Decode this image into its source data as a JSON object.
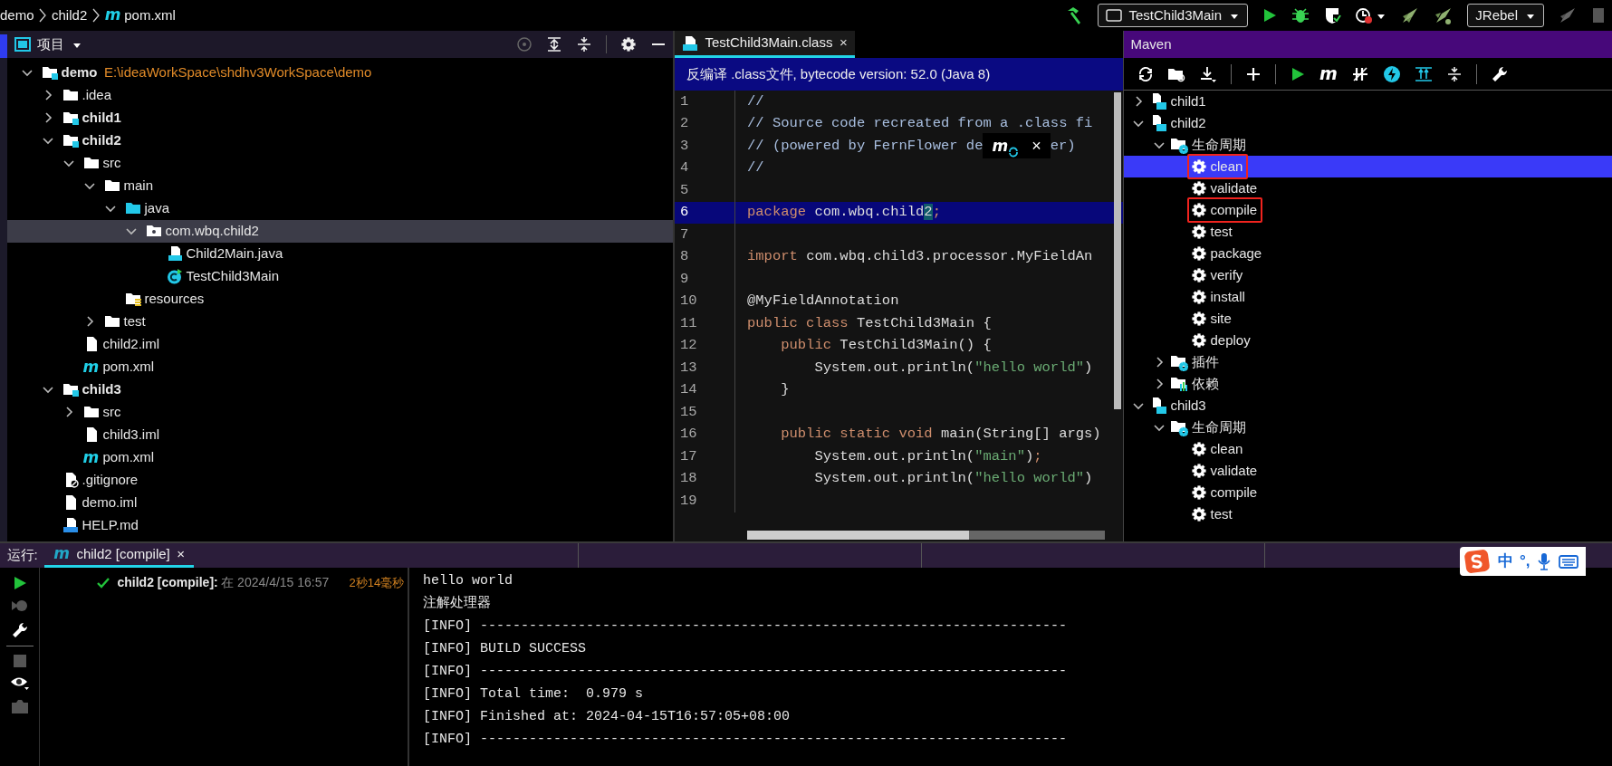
{
  "breadcrumbs": [
    {
      "label": "demo"
    },
    {
      "label": "child2"
    },
    {
      "label": "pom.xml",
      "badge": "m"
    }
  ],
  "toolbar": {
    "run_config": "TestChild3Main",
    "plugin": "JRebel"
  },
  "project_panel": {
    "title": "项目",
    "tree": [
      {
        "label": "demo",
        "kind": "module",
        "bold": true,
        "path": "E:\\ideaWorkSpace\\shdhv3WorkSpace\\demo",
        "expanded": true,
        "selected": false,
        "children": [
          {
            "label": ".idea",
            "kind": "folder",
            "expanded": false,
            "selected": false
          },
          {
            "label": "child1",
            "kind": "module",
            "bold": true,
            "expanded": false,
            "selected": false
          },
          {
            "label": "child2",
            "kind": "module",
            "bold": true,
            "expanded": true,
            "selected": false,
            "children": [
              {
                "label": "src",
                "kind": "folder",
                "expanded": true,
                "selected": false,
                "children": [
                  {
                    "label": "main",
                    "kind": "folder",
                    "expanded": true,
                    "selected": false,
                    "children": [
                      {
                        "label": "java",
                        "kind": "source-folder",
                        "expanded": true,
                        "selected": false,
                        "children": [
                          {
                            "label": "com.wbq.child2",
                            "kind": "package",
                            "expanded": true,
                            "selected": true,
                            "children": [
                              {
                                "label": "Child2Main.java",
                                "kind": "java-file",
                                "selected": false
                              },
                              {
                                "label": "TestChild3Main",
                                "kind": "class",
                                "selected": false
                              }
                            ]
                          }
                        ]
                      },
                      {
                        "label": "resources",
                        "kind": "resources",
                        "selected": false
                      }
                    ]
                  },
                  {
                    "label": "test",
                    "kind": "folder",
                    "expanded": false,
                    "selected": false
                  }
                ]
              },
              {
                "label": "child2.iml",
                "kind": "iml",
                "selected": false
              },
              {
                "label": "pom.xml",
                "kind": "pom",
                "badge": "m",
                "selected": false
              }
            ]
          },
          {
            "label": "child3",
            "kind": "module",
            "bold": true,
            "expanded": true,
            "selected": false,
            "children": [
              {
                "label": "src",
                "kind": "folder",
                "expanded": false,
                "selected": false
              },
              {
                "label": "child3.iml",
                "kind": "iml",
                "selected": false
              },
              {
                "label": "pom.xml",
                "kind": "pom",
                "badge": "m",
                "selected": false
              }
            ]
          },
          {
            "label": ".gitignore",
            "kind": "gitignore",
            "selected": false
          },
          {
            "label": "demo.iml",
            "kind": "iml",
            "selected": false
          },
          {
            "label": "HELP.md",
            "kind": "md",
            "selected": false
          }
        ]
      }
    ]
  },
  "editor": {
    "tab": {
      "label": "TestChild3Main.class",
      "close": "×",
      "selected": true
    },
    "banner": "反编译 .class文件, bytecode version: 52.0 (Java 8)",
    "lines": [
      {
        "number": "1",
        "current": false,
        "tokens": [
          {
            "kind": "comment",
            "text": "//"
          }
        ]
      },
      {
        "number": "2",
        "current": false,
        "tokens": [
          {
            "kind": "comment",
            "text": "// Source code recreated from a .class fi"
          }
        ]
      },
      {
        "number": "3",
        "current": false,
        "tokens": [
          {
            "kind": "comment",
            "text": "// (powered by FernFlower de"
          },
          {
            "kind": "popup",
            "badge": "m",
            "close": "×"
          },
          {
            "kind": "comment",
            "text": "er)"
          }
        ]
      },
      {
        "number": "4",
        "current": false,
        "tokens": [
          {
            "kind": "comment",
            "text": "//"
          }
        ]
      },
      {
        "number": "5",
        "current": false
      },
      {
        "number": "6",
        "current": true,
        "tokens": [
          {
            "kind": "keyword",
            "text": "package "
          },
          {
            "kind": "plain",
            "text": "com.wbq.child"
          },
          {
            "kind": "match",
            "text": "2"
          },
          {
            "kind": "keyword",
            "text": ";"
          }
        ]
      },
      {
        "number": "7",
        "current": false
      },
      {
        "number": "8",
        "current": false,
        "tokens": [
          {
            "kind": "keyword",
            "text": "import "
          },
          {
            "kind": "plain",
            "text": "com.wbq.child3.processor.MyFieldAn"
          }
        ]
      },
      {
        "number": "9",
        "current": false
      },
      {
        "number": "10",
        "current": false,
        "tokens": [
          {
            "kind": "plain",
            "text": "@MyFieldAnnotation"
          }
        ]
      },
      {
        "number": "11",
        "current": false,
        "tokens": [
          {
            "kind": "keyword",
            "text": "public class "
          },
          {
            "kind": "plain",
            "text": "TestChild3Main {"
          }
        ]
      },
      {
        "number": "12",
        "current": false,
        "tokens": [
          {
            "kind": "keyword",
            "text": "    public "
          },
          {
            "kind": "plain",
            "text": "TestChild3Main() {"
          }
        ]
      },
      {
        "number": "13",
        "current": false,
        "tokens": [
          {
            "kind": "plain",
            "text": "        System.out.println("
          },
          {
            "kind": "string",
            "text": "\"hello world\""
          },
          {
            "kind": "plain",
            "text": ")"
          }
        ]
      },
      {
        "number": "14",
        "current": false,
        "tokens": [
          {
            "kind": "plain",
            "text": "    }"
          }
        ]
      },
      {
        "number": "15",
        "current": false
      },
      {
        "number": "16",
        "current": false,
        "tokens": [
          {
            "kind": "keyword",
            "text": "    public static void "
          },
          {
            "kind": "plain",
            "text": "main(String[] args)"
          }
        ]
      },
      {
        "number": "17",
        "current": false,
        "tokens": [
          {
            "kind": "plain",
            "text": "        System.out.println("
          },
          {
            "kind": "string",
            "text": "\"main\""
          },
          {
            "kind": "plain",
            "text": ")"
          },
          {
            "kind": "keyword",
            "text": ";"
          }
        ]
      },
      {
        "number": "18",
        "current": false,
        "tokens": [
          {
            "kind": "plain",
            "text": "        System.out.println("
          },
          {
            "kind": "string",
            "text": "\"hello world\""
          },
          {
            "kind": "plain",
            "text": ")"
          }
        ]
      },
      {
        "number": "19",
        "current": false
      }
    ]
  },
  "maven": {
    "title": "Maven",
    "toolbar_badge": "m",
    "tree": [
      {
        "label": "child1",
        "kind": "module",
        "expanded": false,
        "selected": false,
        "marked": false
      },
      {
        "label": "child2",
        "kind": "module",
        "expanded": true,
        "selected": false,
        "marked": false,
        "children": [
          {
            "label": "生命周期",
            "kind": "lifecycle",
            "expanded": true,
            "selected": false,
            "marked": false,
            "children": [
              {
                "label": "clean",
                "kind": "goal",
                "selected": true,
                "marked": true
              },
              {
                "label": "validate",
                "kind": "goal",
                "selected": false,
                "marked": false
              },
              {
                "label": "compile",
                "kind": "goal",
                "selected": false,
                "marked": true
              },
              {
                "label": "test",
                "kind": "goal",
                "selected": false,
                "marked": false
              },
              {
                "label": "package",
                "kind": "goal",
                "selected": false,
                "marked": false
              },
              {
                "label": "verify",
                "kind": "goal",
                "selected": false,
                "marked": false
              },
              {
                "label": "install",
                "kind": "goal",
                "selected": false,
                "marked": false
              },
              {
                "label": "site",
                "kind": "goal",
                "selected": false,
                "marked": false
              },
              {
                "label": "deploy",
                "kind": "goal",
                "selected": false,
                "marked": false
              }
            ]
          },
          {
            "label": "插件",
            "kind": "plugins",
            "expanded": false,
            "selected": false,
            "marked": false
          },
          {
            "label": "依赖",
            "kind": "dependencies",
            "expanded": false,
            "selected": false,
            "marked": false
          }
        ]
      },
      {
        "label": "child3",
        "kind": "module",
        "expanded": true,
        "selected": false,
        "marked": false,
        "children": [
          {
            "label": "生命周期",
            "kind": "lifecycle",
            "expanded": true,
            "selected": false,
            "marked": false,
            "children": [
              {
                "label": "clean",
                "kind": "goal",
                "selected": false,
                "marked": false
              },
              {
                "label": "validate",
                "kind": "goal",
                "selected": false,
                "marked": false
              },
              {
                "label": "compile",
                "kind": "goal",
                "selected": false,
                "marked": false
              },
              {
                "label": "test",
                "kind": "goal",
                "selected": false,
                "marked": false
              }
            ]
          }
        ]
      }
    ]
  },
  "run_panel": {
    "label": "运行:",
    "tab": {
      "badge": "m",
      "label": "child2 [compile]",
      "close": "×",
      "selected": true
    },
    "runs": [
      {
        "name": "child2 [compile]:",
        "time": "在 2024/4/15 16:57",
        "duration": "2秒14毫秒"
      }
    ],
    "console": [
      "hello world",
      "注解处理器",
      "[INFO] ------------------------------------------------------------------------",
      "[INFO] BUILD SUCCESS",
      "[INFO] ------------------------------------------------------------------------",
      "[INFO] Total time:  0.979 s",
      "[INFO] Finished at: 2024-04-15T16:57:05+08:00",
      "[INFO] ------------------------------------------------------------------------"
    ]
  },
  "ime": {
    "mode": "中",
    "punctuation": "°,"
  }
}
